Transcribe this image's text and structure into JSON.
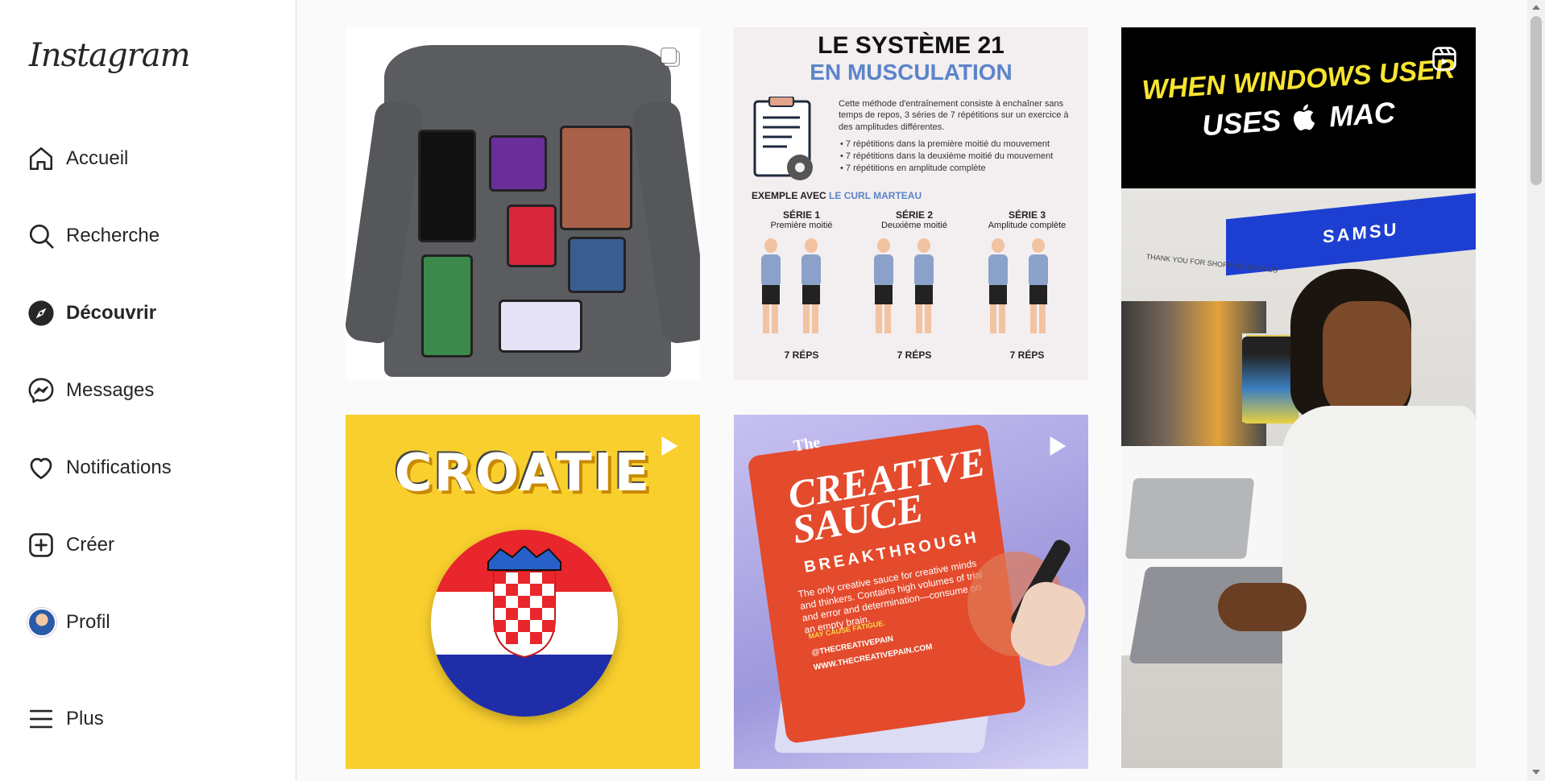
{
  "app": {
    "logo": "Instagram"
  },
  "sidebar": {
    "items": [
      {
        "label": "Accueil",
        "icon": "home-icon"
      },
      {
        "label": "Recherche",
        "icon": "search-icon"
      },
      {
        "label": "Découvrir",
        "icon": "compass-icon",
        "active": true
      },
      {
        "label": "Messages",
        "icon": "messenger-icon"
      },
      {
        "label": "Notifications",
        "icon": "heart-icon"
      },
      {
        "label": "Créer",
        "icon": "plus-square-icon"
      },
      {
        "label": "Profil",
        "icon": "avatar"
      }
    ],
    "more": {
      "label": "Plus",
      "icon": "menu-icon"
    }
  },
  "posts": {
    "p1": {
      "kind": "carousel",
      "icon": "carousel-icon"
    },
    "p2": {
      "title1": "LE SYSTÈME 21",
      "title2": "EN MUSCULATION",
      "intro": "Cette méthode d'entraînement consiste à enchaîner sans temps de repos, 3 séries de 7 répétitions sur un exercice à des amplitudes différentes.",
      "bullets": [
        "7 répétitions dans la première moitié du mouvement",
        "7 répétitions dans la deuxième moitié du mouvement",
        "7 répétitions en amplitude complète"
      ],
      "example_prefix": "EXEMPLE AVEC ",
      "example_name": "LE CURL MARTEAU",
      "series": [
        {
          "title": "SÉRIE 1",
          "sub": "Première moitié",
          "reps": "7 RÉPS"
        },
        {
          "title": "SÉRIE 2",
          "sub": "Deuxième moitié",
          "reps": "7 RÉPS"
        },
        {
          "title": "SÉRIE 3",
          "sub": "Amplitude complète",
          "reps": "7 RÉPS"
        }
      ]
    },
    "p3": {
      "kind": "reel",
      "line1": "WHEN WINDOWS USER",
      "line2a": "USES",
      "line2b": "MAC",
      "store_sign": "SAMSU",
      "banner": "THANK YOU FOR SHOPPING WITH US"
    },
    "p4": {
      "kind": "video",
      "word": "CROATIE"
    },
    "p5": {
      "kind": "video",
      "the": "The",
      "line1": "CREATIVE",
      "line2": "SAUCE",
      "line3": "BREAKTHROUGH",
      "desc": "The only creative sauce for creative minds and thinkers. Contains high volumes of trial and error and determination—consume on an empty brain.",
      "warn": "MAY CAUSE FATIGUE.",
      "handle": "@THECREATIVEPAIN",
      "site": "WWW.THECREATIVEPAIN.COM"
    }
  },
  "colors": {
    "accent_blue": "#5b84c9",
    "croatia_red": "#e8262b",
    "croatia_blue": "#1f2ea8",
    "sauce_red": "#e44a2c",
    "yellow": "#f9cf2e"
  }
}
